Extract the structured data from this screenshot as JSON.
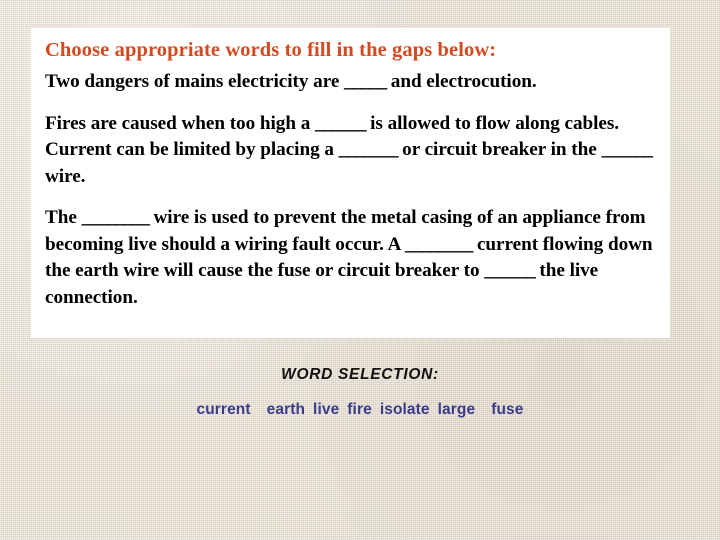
{
  "slide": {
    "background_color": "#e5ded1",
    "card_color": "#ffffff"
  },
  "card": {
    "title": "Choose appropriate words to fill in the gaps below:",
    "title_color": "#d4491f",
    "paragraphs": [
      {
        "id": "par-1",
        "segments": [
          {
            "type": "text",
            "value": "Two dangers of mains electricity are "
          },
          {
            "type": "gap",
            "value": "_____"
          },
          {
            "type": "text",
            "value": " and electrocution."
          }
        ],
        "plain": "Two dangers of mains electricity are _____ and electrocution."
      },
      {
        "id": "par-2",
        "segments": [
          {
            "type": "text",
            "value": "Fires are caused when too high a "
          },
          {
            "type": "gap",
            "value": "______"
          },
          {
            "type": "text",
            "value": " is allowed to flow along cables. Current can be limited by placing a "
          },
          {
            "type": "gap",
            "value": "_______"
          },
          {
            "type": "text",
            "value": " or circuit breaker in the "
          },
          {
            "type": "gap",
            "value": "______"
          },
          {
            "type": "text",
            "value": " wire."
          }
        ],
        "plain": "Fires are caused when too high a ______ is allowed to flow along cables. Current can be limited by placing a _______ or circuit breaker in the ______ wire."
      },
      {
        "id": "par-3",
        "segments": [
          {
            "type": "text",
            "value": "The "
          },
          {
            "type": "gap",
            "value": "________"
          },
          {
            "type": "text",
            "value": " wire is used to prevent the metal casing of an appliance from becoming live should a wiring fault occur. A "
          },
          {
            "type": "gap",
            "value": "________"
          },
          {
            "type": "text",
            "value": " current flowing down the earth wire will cause the fuse or circuit breaker to "
          },
          {
            "type": "gap",
            "value": "______"
          },
          {
            "type": "text",
            "value": " the live connection."
          }
        ],
        "plain": "The ________ wire is used to prevent the metal casing of an appliance from becoming live should a wiring fault occur. A ________ current flowing down the earth wire will cause the fuse or circuit breaker to ______ the live connection."
      }
    ]
  },
  "word_selection": {
    "heading": "WORD SELECTION:",
    "heading_color": "#111111",
    "word_color": "#3b3b8c",
    "words": [
      "current",
      "earth",
      "live",
      "fire",
      "isolate",
      "large",
      "fuse"
    ]
  }
}
